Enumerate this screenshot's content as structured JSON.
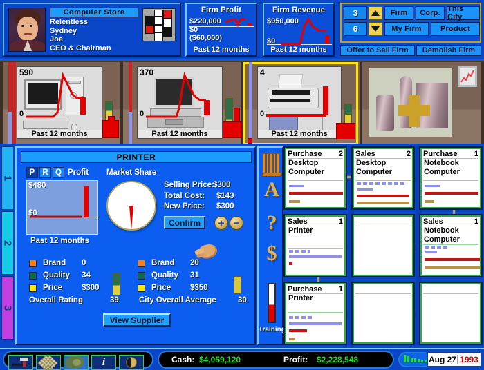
{
  "header": {
    "store_title": "Computer Store",
    "company": "Relentless",
    "city": "Sydney",
    "ceo_name": "Joe",
    "ceo_role": "CEO & Chairman",
    "portrait_icon": "ceo-portrait-icon",
    "logo_icon": "company-logo-icon"
  },
  "firm_profit": {
    "title": "Firm Profit",
    "top_value": "$220,000",
    "mid_value": "$0",
    "low_value": "($60,000)",
    "footer": "Past 12 months"
  },
  "firm_revenue": {
    "title": "Firm Revenue",
    "top_value": "$950,000",
    "zero_value": "$0",
    "footer": "Past 12 months"
  },
  "controls": {
    "spin_top_value": "3",
    "spin_bottom_value": "6",
    "up_icon": "arrow-up-icon",
    "down_icon": "arrow-down-icon",
    "firm": "Firm",
    "corp": "Corp.",
    "this_city": "This City",
    "my_firm": "My Firm",
    "product": "Product",
    "offer_to_sell": "Offer to Sell Firm",
    "demolish": "Demolish Firm"
  },
  "shelf": {
    "items": [
      {
        "value": "590",
        "zero": "0",
        "footer": "Past 12 months",
        "icon": "desktop-computer-icon",
        "selected": false
      },
      {
        "value": "370",
        "zero": "0",
        "footer": "Past 12 months",
        "icon": "notebook-computer-icon",
        "selected": false
      },
      {
        "value": "4",
        "zero": "0",
        "footer": "Past 12 months",
        "icon": "printer-icon",
        "selected": true
      }
    ],
    "decor_icon": "product-display-icon",
    "wall_frame_icon": "framed-chart-icon"
  },
  "side_tabs": [
    {
      "label": "1",
      "color": "#22b4f5"
    },
    {
      "label": "2",
      "color": "#16cbe8"
    },
    {
      "label": "3",
      "color": "#c13fe0"
    }
  ],
  "printer_panel": {
    "title": "PRINTER",
    "prq": [
      {
        "label": "P",
        "active": true
      },
      {
        "label": "R",
        "active": false
      },
      {
        "label": "Q",
        "active": false
      }
    ],
    "profit_label": "Profit",
    "profit_top": "$480",
    "profit_zero": "$0",
    "profit_footer": "Past 12 months",
    "market_share_label": "Market Share",
    "market_share_percent": 3,
    "selling_price_label": "Selling Price:",
    "selling_price_value": "$300",
    "total_cost_label": "Total Cost:",
    "total_cost_value": "$143",
    "new_price_label": "New Price:",
    "new_price_value": "$300",
    "confirm_label": "Confirm",
    "plus_icon": "plus-icon",
    "minus_icon": "minus-icon",
    "cursor_icon": "hand-cursor-icon",
    "my_stats": [
      {
        "swatch": "#ff7b19",
        "label": "Brand",
        "value": "0"
      },
      {
        "swatch": "#0e6a4d",
        "label": "Quality",
        "value": "34"
      },
      {
        "swatch": "#ffe800",
        "label": "Price",
        "value": "$300"
      }
    ],
    "city_stats": [
      {
        "swatch": "#ff7b19",
        "label": "Brand",
        "value": "20"
      },
      {
        "swatch": "#0e6a4d",
        "label": "Quality",
        "value": "31"
      },
      {
        "swatch": "#ffe800",
        "label": "Price",
        "value": "$350"
      }
    ],
    "overall_rating_label": "Overall Rating",
    "overall_rating_value": "39",
    "city_average_label": "City Overall Average",
    "city_average_value": "30",
    "view_supplier_label": "View Supplier"
  },
  "icon_column": {
    "items": [
      {
        "icon": "books-icon",
        "glyph": ""
      },
      {
        "icon": "advertising-icon",
        "glyph": "A"
      },
      {
        "icon": "help-icon",
        "glyph": "?"
      },
      {
        "icon": "finance-icon",
        "glyph": "$"
      }
    ],
    "training_icon": "training-thermometer-icon",
    "training_label": "Training"
  },
  "grid_cards": [
    {
      "type": "Purchase",
      "count": "2",
      "lines": [
        "Desktop",
        "Computer"
      ],
      "empty": false,
      "dashed": false
    },
    {
      "type": "Sales",
      "count": "2",
      "lines": [
        "Desktop",
        "Computer"
      ],
      "empty": false,
      "dashed": true
    },
    {
      "type": "Purchase",
      "count": "1",
      "lines": [
        "Notebook",
        "Computer"
      ],
      "empty": false,
      "dashed": false
    },
    {
      "type": "Sales",
      "count": "1",
      "lines": [
        "Printer"
      ],
      "empty": false,
      "dashed": true
    },
    {
      "type": "",
      "count": "",
      "lines": [],
      "empty": true,
      "dashed": false
    },
    {
      "type": "Sales",
      "count": "1",
      "lines": [
        "Notebook",
        "Computer"
      ],
      "empty": false,
      "dashed": true
    },
    {
      "type": "Purchase",
      "count": "1",
      "lines": [
        "Printer"
      ],
      "empty": false,
      "dashed": true
    },
    {
      "type": "",
      "count": "",
      "lines": [],
      "empty": true,
      "dashed": false
    },
    {
      "type": "",
      "count": "",
      "lines": [],
      "empty": true,
      "dashed": false
    }
  ],
  "statusbar": {
    "tools": [
      {
        "icon": "build-hammer-icon"
      },
      {
        "icon": "city-map-icon"
      },
      {
        "icon": "world-map-icon"
      },
      {
        "icon": "info-icon"
      },
      {
        "icon": "clock-icon"
      }
    ],
    "cash_label": "Cash:",
    "cash_value": "$4,059,120",
    "profit_label": "Profit:",
    "profit_value": "$2,228,548",
    "speed_icon": "speed-gauge-icon",
    "date_month": "Aug 27",
    "date_year": "1993"
  }
}
